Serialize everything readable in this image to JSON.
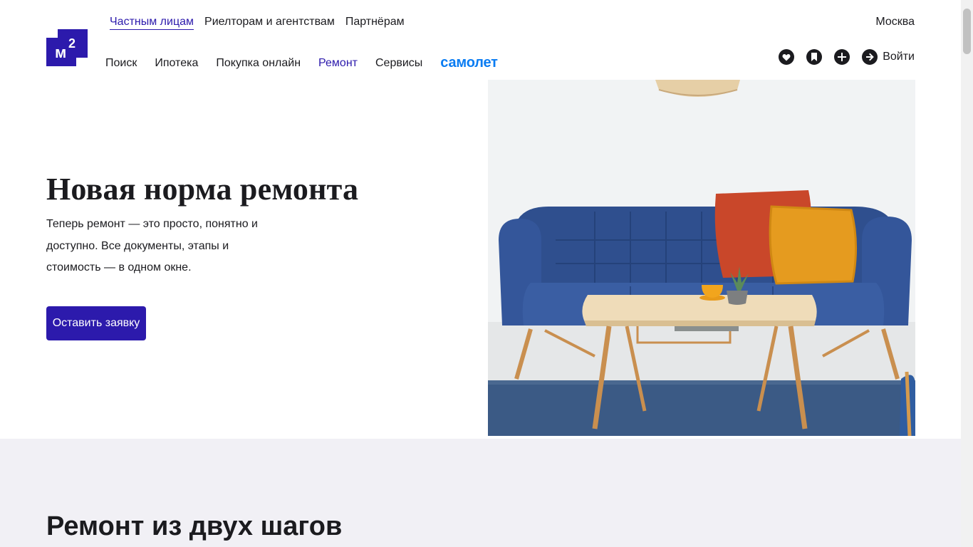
{
  "logo": {
    "text": "м",
    "sup": "2",
    "color": "#2c1aac"
  },
  "top_nav": [
    {
      "label": "Частным лицам",
      "active": true
    },
    {
      "label": "Риелторам и агентствам",
      "active": false
    },
    {
      "label": "Партнёрам",
      "active": false
    }
  ],
  "city": "Москва",
  "main_nav": {
    "items": [
      {
        "label": "Поиск"
      },
      {
        "label": "Ипотека"
      },
      {
        "label": "Покупка онлайн"
      },
      {
        "label": "Ремонт"
      },
      {
        "label": "Сервисы"
      }
    ],
    "brand": "самолет"
  },
  "actions": {
    "icons": [
      "heart-icon",
      "bookmark-icon",
      "plus-icon",
      "login-arrow-icon"
    ],
    "login_label": "Войти"
  },
  "hero": {
    "title": "Новая норма ремонта",
    "text": "Теперь ремонт — это просто, понятно и доступно. Все документы, этапы и стоимость — в одном окне.",
    "cta": "Оставить заявку",
    "image": "blue-sofa-living-room"
  },
  "section2": {
    "title": "Ремонт из двух шагов"
  },
  "colors": {
    "accent": "#2c1aac",
    "brand": "#0a7cf2",
    "section_bg": "#f1f0f5",
    "text": "#1b1b1f"
  }
}
